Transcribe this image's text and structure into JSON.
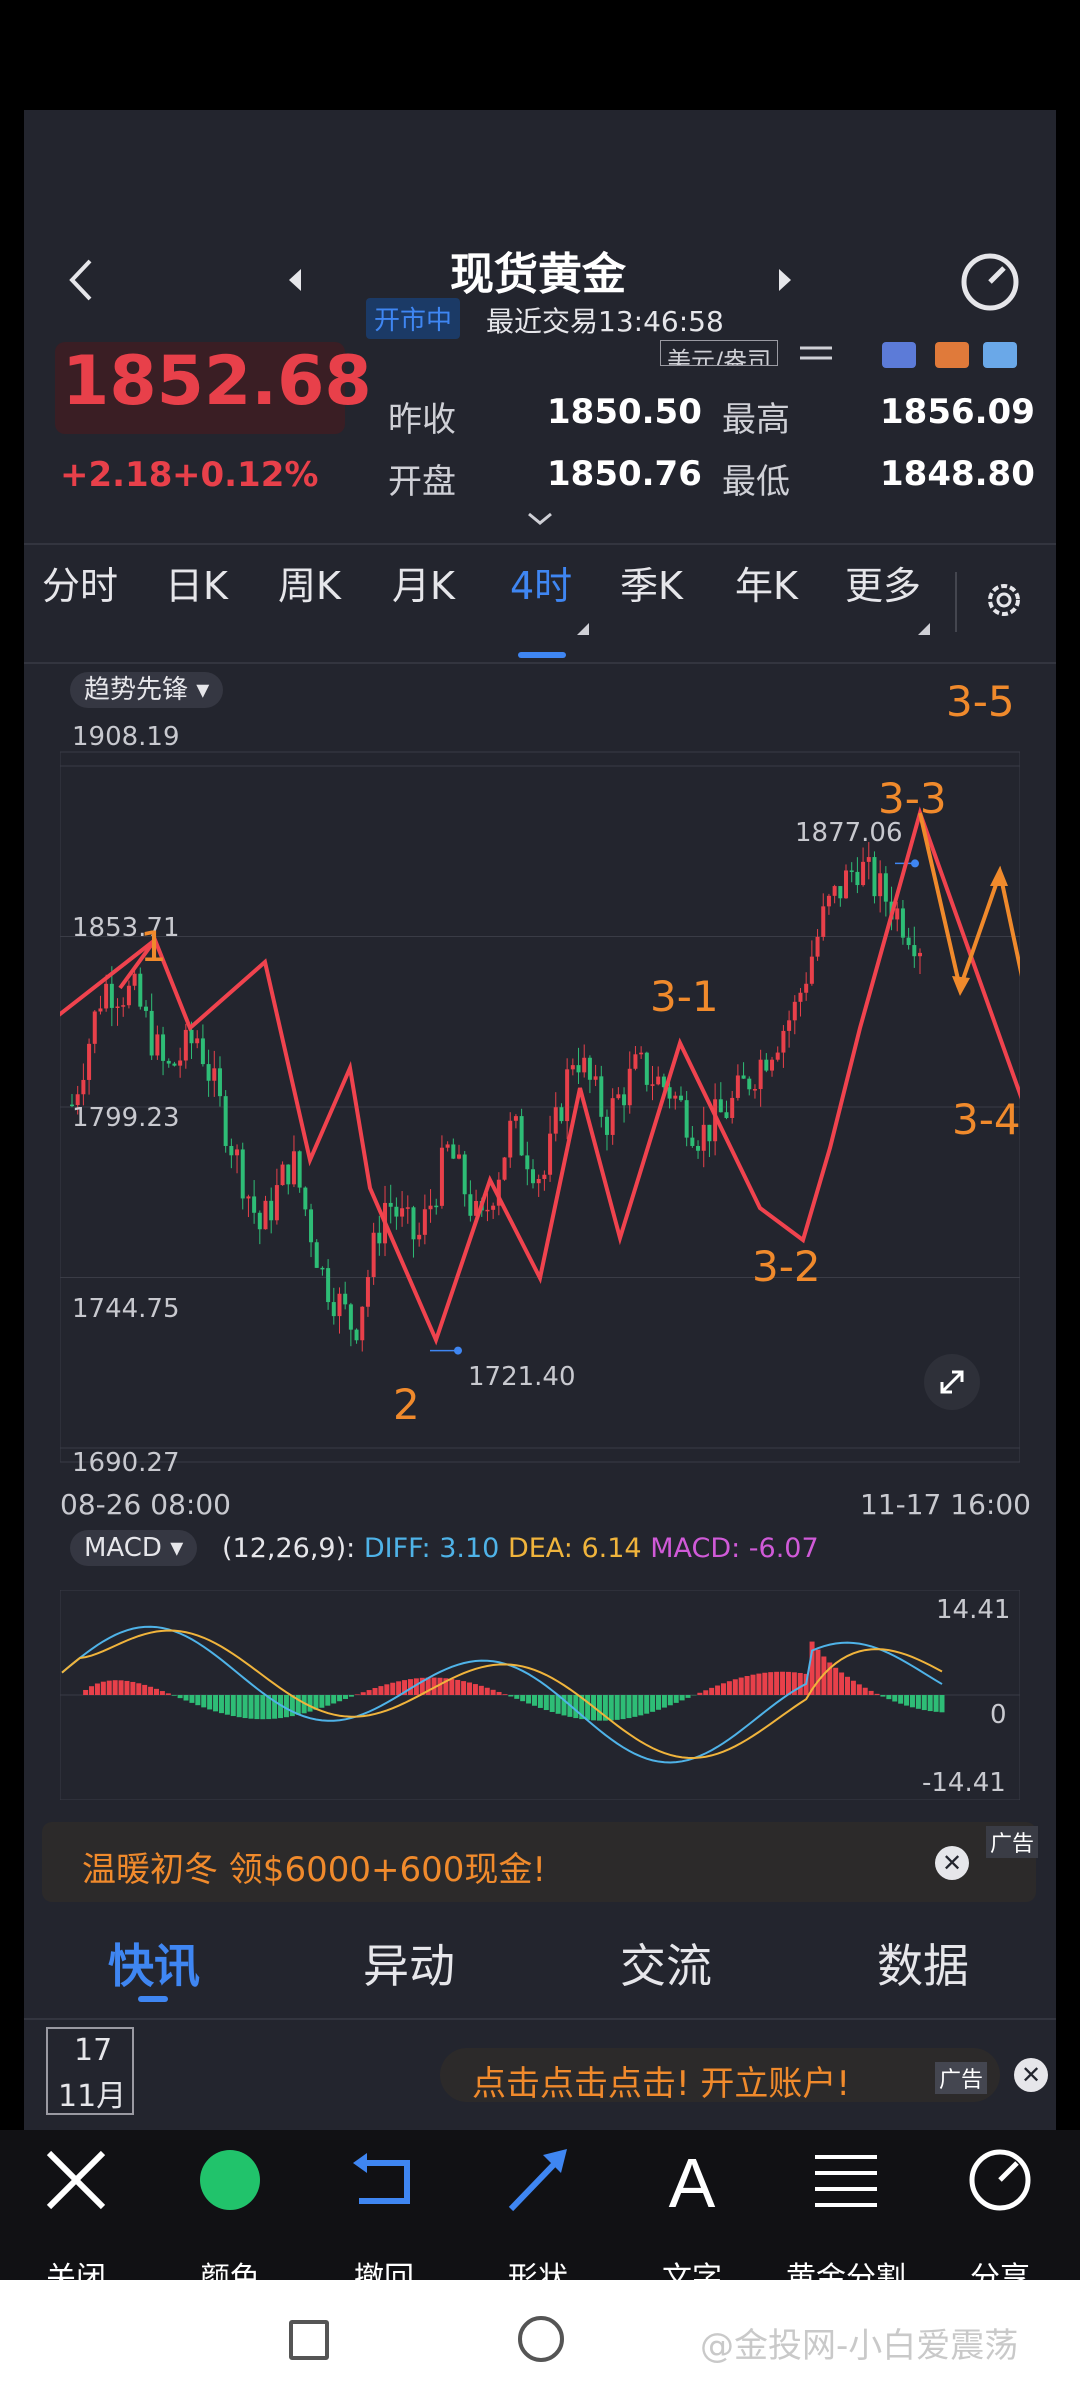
{
  "header": {
    "title": "现货黄金",
    "status_badge": "开市中",
    "last_trade": "最近交易13:46:58",
    "unit_chip": "美元/盎司"
  },
  "quote": {
    "price": "1852.68",
    "change": "+2.18",
    "change_pct": "+0.12%",
    "prev_close_label": "昨收",
    "prev_close": "1850.50",
    "high_label": "最高",
    "high": "1856.09",
    "open_label": "开盘",
    "open": "1850.76",
    "low_label": "最低",
    "low": "1848.80"
  },
  "period_tabs": [
    "分时",
    "日K",
    "周K",
    "月K",
    "4时",
    "季K",
    "年K",
    "更多"
  ],
  "active_tab": "4时",
  "indicator_select": "趋势先锋",
  "chart": {
    "y_ticks": [
      "1908.19",
      "1853.71",
      "1799.23",
      "1744.75",
      "1690.27"
    ],
    "x_start": "08-26 08:00",
    "x_end": "11-17 16:00",
    "high_marker": "1877.06",
    "low_marker": "1721.40",
    "wave_labels": [
      "1",
      "2",
      "3-1",
      "3-2",
      "3-3",
      "3-4",
      "3-5"
    ]
  },
  "macd": {
    "select": "MACD",
    "params": "(12,26,9):",
    "diff": "DIFF: 3.10",
    "dea": "DEA: 6.14",
    "macd": "MACD: -6.07",
    "y_top": "14.41",
    "y_mid": "0",
    "y_bottom": "-14.41"
  },
  "ad1": {
    "text": "温暖初冬 领$6000+600现金!",
    "tag": "广告"
  },
  "news_tabs": [
    "快讯",
    "异动",
    "交流",
    "数据"
  ],
  "news_active": "快讯",
  "date_card": {
    "day": "17",
    "month": "11月"
  },
  "ad2": {
    "text": "点击点击点击! 开立账户!",
    "tag": "广告"
  },
  "toolbar": [
    "关闭",
    "颜色",
    "撤回",
    "形状",
    "文字",
    "黄金分割",
    "分享"
  ],
  "watermark": "@金投网-小白爱震荡",
  "chart_data": [
    {
      "type": "candlestick",
      "title": "",
      "x_range": [
        "08-26 08:00",
        "11-17 16:00"
      ],
      "ylim": [
        1690.27,
        1908.19
      ],
      "y_ticks": [
        1908.19,
        1853.71,
        1799.23,
        1744.75,
        1690.27
      ],
      "annotations": [
        {
          "label": "1877.06",
          "kind": "high"
        },
        {
          "label": "1721.40",
          "kind": "low"
        }
      ],
      "series": [
        {
          "name": "close_approx",
          "values": [
            1800,
            1838,
            1835,
            1810,
            1822,
            1790,
            1760,
            1783,
            1745,
            1728,
            1770,
            1756,
            1786,
            1760,
            1793,
            1776,
            1818,
            1795,
            1812,
            1805,
            1790,
            1800,
            1815,
            1830,
            1862,
            1877,
            1865,
            1852
          ]
        }
      ]
    },
    {
      "type": "bar",
      "title": "",
      "ylim": [
        -14.41,
        14.41
      ],
      "series": [
        {
          "name": "DIFF",
          "last": 3.1
        },
        {
          "name": "DEA",
          "last": 6.14
        },
        {
          "name": "MACD",
          "last": -6.07
        }
      ]
    }
  ],
  "colors": {
    "up": "#e8404a",
    "down": "#2ebd76",
    "accent": "#3f86f2",
    "annotation": "#f08a2c",
    "diff": "#4fb3e8",
    "dea": "#f0b43c",
    "macd": "#d05ad8"
  }
}
